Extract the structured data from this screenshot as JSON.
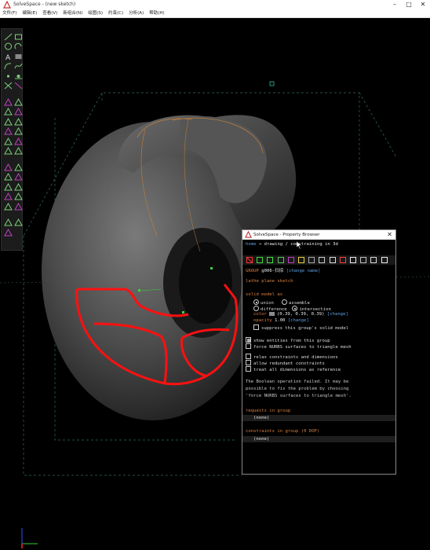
{
  "window": {
    "title": "SolveSpace - (new sketch)"
  },
  "menu": [
    "文件(F)",
    "编辑(E)",
    "查看(V)",
    "新组合(N)",
    "绘图(S)",
    "约束(C)",
    "分析(A)",
    "帮助(H)"
  ],
  "toolbar": {
    "tools": [
      "line",
      "rectangle",
      "circle",
      "arc",
      "text",
      "image",
      "tangent-arc",
      "cubic-spline",
      "datum-point",
      "workplane",
      "construction-toggle",
      "split-curves",
      "dimension",
      "angle",
      "horizontal",
      "vertical",
      "parallel",
      "perpendicular",
      "point-on",
      "midpoint",
      "symmetric",
      "equal",
      "same-orientation",
      "reference",
      "extrude",
      "lathe",
      "revolve",
      "helix",
      "link",
      "step-rotating",
      "step-translating",
      "nearest-iso",
      "ortho",
      "other-supplement",
      "tangent",
      "comment",
      "grid"
    ]
  },
  "property_browser": {
    "title": "SolveSpace - Property Browser",
    "nav": {
      "home": "home",
      "sep": "→",
      "status": "drawing / constraining in 3d"
    },
    "group_line": {
      "label": "GROUP",
      "name": "g006-扫掠",
      "change": "[change name]"
    },
    "group_type": "lathe plane sketch",
    "solid_model_as": "solid model as",
    "options": {
      "union": "union",
      "assemble": "assemble",
      "difference": "difference",
      "intersection": "intersection"
    },
    "color": {
      "label": "color",
      "value": "(0.39, 0.39, 0.39)",
      "change": "[change]"
    },
    "opacity": {
      "label": "opacity",
      "value": "1.00",
      "change": "[change]"
    },
    "suppress": "suppress this group's solid model",
    "checks": {
      "show_entities": "show entities from this group",
      "force_nurbs": "force NURBS surfaces to triangle mesh",
      "relax": "relax constraints and dimensions",
      "allow_redundant": "allow redundant constraints",
      "treat_reference": "treat all dimensions as reference"
    },
    "message": [
      "The Boolean operation failed. It may be",
      "possible to fix the problem by choosing",
      "'force NURBS surfaces to triangle mesh'."
    ],
    "requests": {
      "title": "requests in group",
      "value": "(none)"
    },
    "constraints": {
      "title": "constraints in group (0 DOF)",
      "value": "(none)"
    }
  },
  "colors": {
    "toolbar_icon": "#c040c0",
    "line_icon": "#7ad07a",
    "sketch_red": "#ff1010",
    "link_blue": "#5c9fe0",
    "section_orange": "#d98040"
  }
}
